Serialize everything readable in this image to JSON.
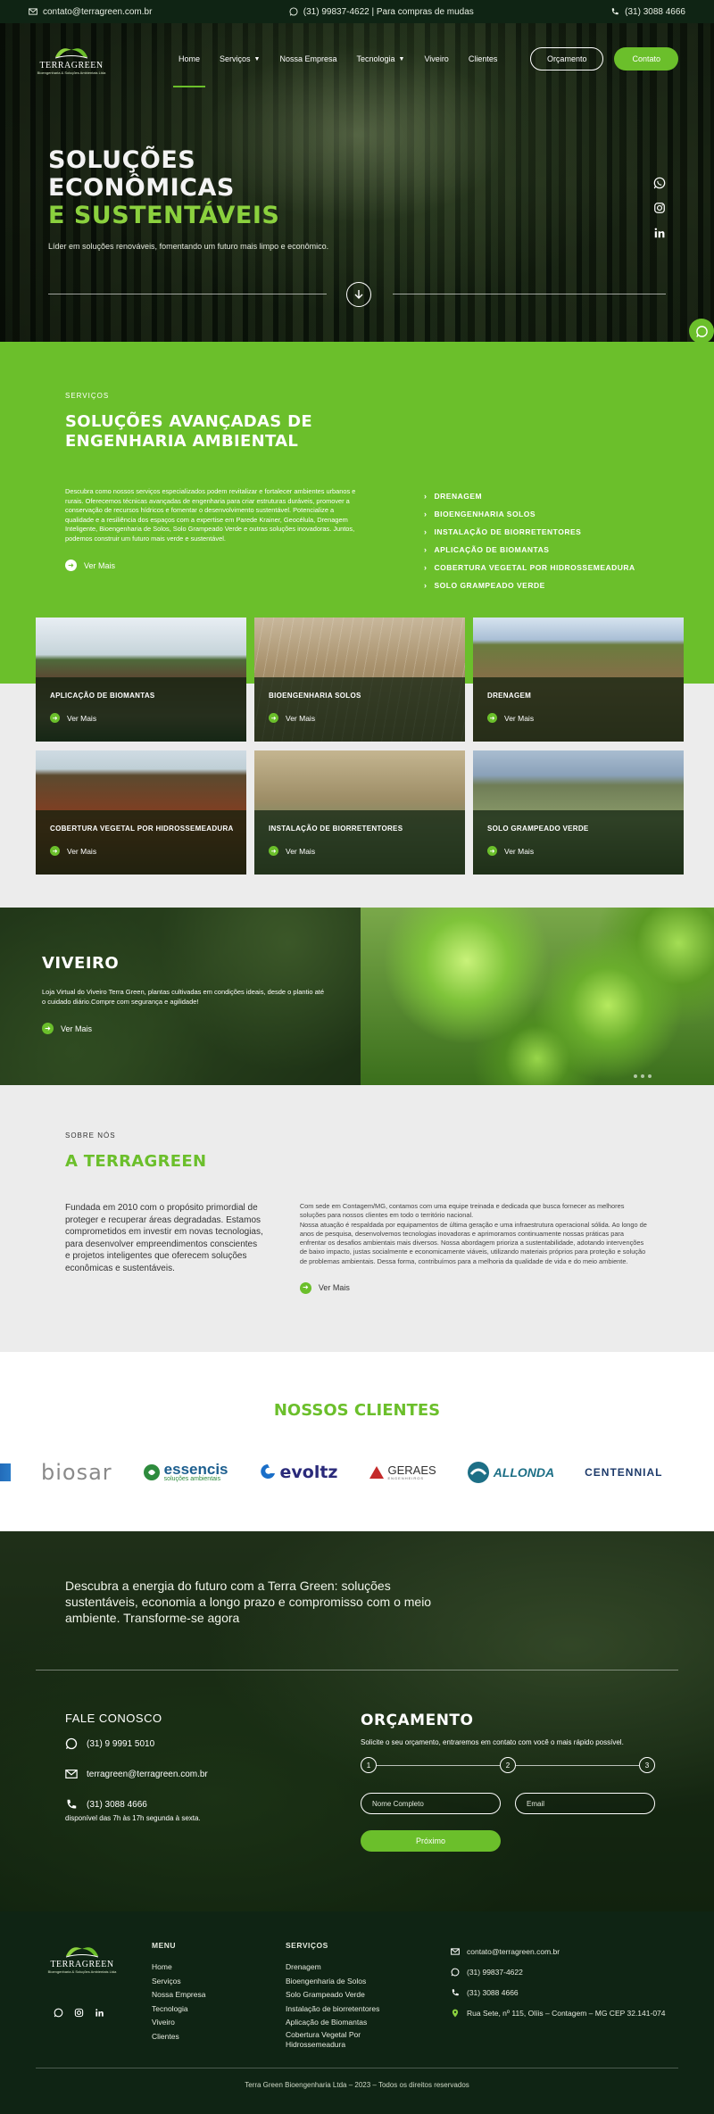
{
  "topbar": {
    "email": "contato@terragreen.com.br",
    "whatsapp": "(31) 99837-4622 | Para compras de mudas",
    "phone": "(31) 3088 4666"
  },
  "brand": {
    "name": "TERRAGREEN",
    "tagline": "Bioengenharia & Soluções Ambientais Ltda"
  },
  "nav": {
    "items": [
      {
        "label": "Home",
        "active": true
      },
      {
        "label": "Serviços",
        "caret": true
      },
      {
        "label": "Nossa Empresa"
      },
      {
        "label": "Tecnologia",
        "caret": true
      },
      {
        "label": "Viveiro"
      },
      {
        "label": "Clientes"
      }
    ],
    "orcamento": "Orçamento",
    "contato": "Contato"
  },
  "hero": {
    "line1": "SOLUÇÕES",
    "line2": "ECONÔMICAS",
    "line3": "E SUSTENTÁVEIS",
    "subtitle": "Líder em soluções renováveis, fomentando um futuro mais limpo e econômico.",
    "socials": [
      "whatsapp-icon",
      "instagram-icon",
      "linkedin-icon"
    ]
  },
  "services": {
    "kicker": "SERVIÇOS",
    "title_line1": "SOLUÇÕES AVANÇADAS DE",
    "title_line2": "ENGENHARIA AMBIENTAL",
    "text": "Descubra como nossos serviços especializados podem revitalizar e fortalecer ambientes urbanos e rurais. Oferecemos técnicas avançadas de engenharia para criar estruturas duráveis, promover a conservação de recursos hídricos e fomentar o desenvolvimento sustentável. Potencialize a qualidade e a resiliência dos espaços com a expertise em Parede Krainer, Geocélula, Drenagem Inteligente, Bioengenharia de Solos, Solo Grampeado Verde e outras soluções inovadoras. Juntos, podemos construir um futuro mais verde e sustentável.",
    "see_more": "Ver Mais",
    "list": [
      "DRENAGEM",
      "BIOENGENHARIA SOLOS",
      "INSTALAÇÃO DE BIORRETENTORES",
      "APLICAÇÃO DE BIOMANTAS",
      "COBERTURA VEGETAL POR HIDROSSEMEADURA",
      "SOLO GRAMPEADO VERDE"
    ]
  },
  "cards": [
    {
      "title": "APLICAÇÃO DE BIOMANTAS",
      "link": "Ver Mais"
    },
    {
      "title": "BIOENGENHARIA SOLOS",
      "link": "Ver Mais"
    },
    {
      "title": "DRENAGEM",
      "link": "Ver Mais"
    },
    {
      "title": "COBERTURA VEGETAL POR HIDROSSEMEADURA",
      "link": "Ver Mais"
    },
    {
      "title": "INSTALAÇÃO DE BIORRETENTORES",
      "link": "Ver Mais"
    },
    {
      "title": "SOLO GRAMPEADO VERDE",
      "link": "Ver Mais"
    }
  ],
  "viveiro": {
    "title": "VIVEIRO",
    "text": "Loja Virtual do Viveiro Terra Green, plantas cultivadas em condições ideais, desde o plantio até o cuidado diário.Compre com segurança e agilidade!",
    "see_more": "Ver Mais"
  },
  "about": {
    "kicker": "SOBRE NÓS",
    "title": "A TERRAGREEN",
    "left": "Fundada em 2010 com o propósito primordial de proteger e recuperar áreas degradadas. Estamos comprometidos em investir em novas tecnologias, para desenvolver empreendimentos conscientes e projetos inteligentes que oferecem soluções econômicas e sustentáveis.",
    "right_p1": "Com sede em Contagem/MG, contamos com uma equipe treinada e dedicada que busca fornecer as melhores soluções para nossos clientes em todo o território nacional.",
    "right_p2": "Nossa atuação é respaldada por equipamentos de última geração e uma infraestrutura operacional sólida. Ao longo de anos de pesquisa, desenvolvemos tecnologias inovadoras e aprimoramos continuamente nossas práticas para enfrentar os desafios ambientais mais diversos. Nossa abordagem prioriza a sustentabilidade, adotando intervenções de baixo impacto, justas socialmente e economicamente viáveis, utilizando materiais próprios para proteção e solução de problemas ambientais. Dessa forma, contribuímos para a melhoria da qualidade de vida e do meio ambiente.",
    "see_more": "Ver Mais"
  },
  "clients": {
    "title": "NOSSOS CLIENTES",
    "logos": [
      "biosar",
      "essencis",
      "evoltz",
      "GERAES",
      "ALLONDA",
      "CENTENNIAL"
    ],
    "essencis_sub": "soluções ambientais",
    "geraes_sub": "ENGENHEIROS"
  },
  "contact": {
    "cta": "Descubra a energia do futuro com a Terra Green: soluções sustentáveis, economia a longo prazo e compromisso com o meio ambiente. Transforme-se agora",
    "fale_title": "FALE CONOSCO",
    "whatsapp": "(31) 9 9991 5010",
    "email": "terragreen@terragreen.com.br",
    "phone": "(31) 3088 4666",
    "hours": "disponível das 7h às 17h segunda à sexta.",
    "orc_title": "ORÇAMENTO",
    "orc_sub": "Solicite o seu orçamento, entraremos em contato com você o mais rápido possível.",
    "steps": [
      "1",
      "2",
      "3"
    ],
    "name_placeholder": "Nome Completo",
    "email_placeholder": "Email",
    "next": "Próximo"
  },
  "footer": {
    "menu_title": "MENU",
    "menu": [
      "Home",
      "Serviços",
      "Nossa Empresa",
      "Tecnologia",
      "Viveiro",
      "Clientes"
    ],
    "services_title": "SERVIÇOS",
    "services": [
      "Drenagem",
      "Bioengenharia de Solos",
      "Solo Grampeado Verde",
      "Instalação de biorretentores",
      "Aplicação de Biomantas",
      "Cobertura Vegetal Por Hidrossemeadura"
    ],
    "email": "contato@terragreen.com.br",
    "whatsapp": "(31) 99837-4622",
    "phone": "(31) 3088 4666",
    "address": "Rua Sete, nº 115, Olíis – Contagem – MG CEP 32.141-074",
    "copyright": "Terra Green Bioengenharia Ltda – 2023 – Todos os direitos reservados"
  },
  "colors": {
    "accent": "#6bbf2b",
    "dark": "#0f2414",
    "light_gray": "#ececec"
  }
}
